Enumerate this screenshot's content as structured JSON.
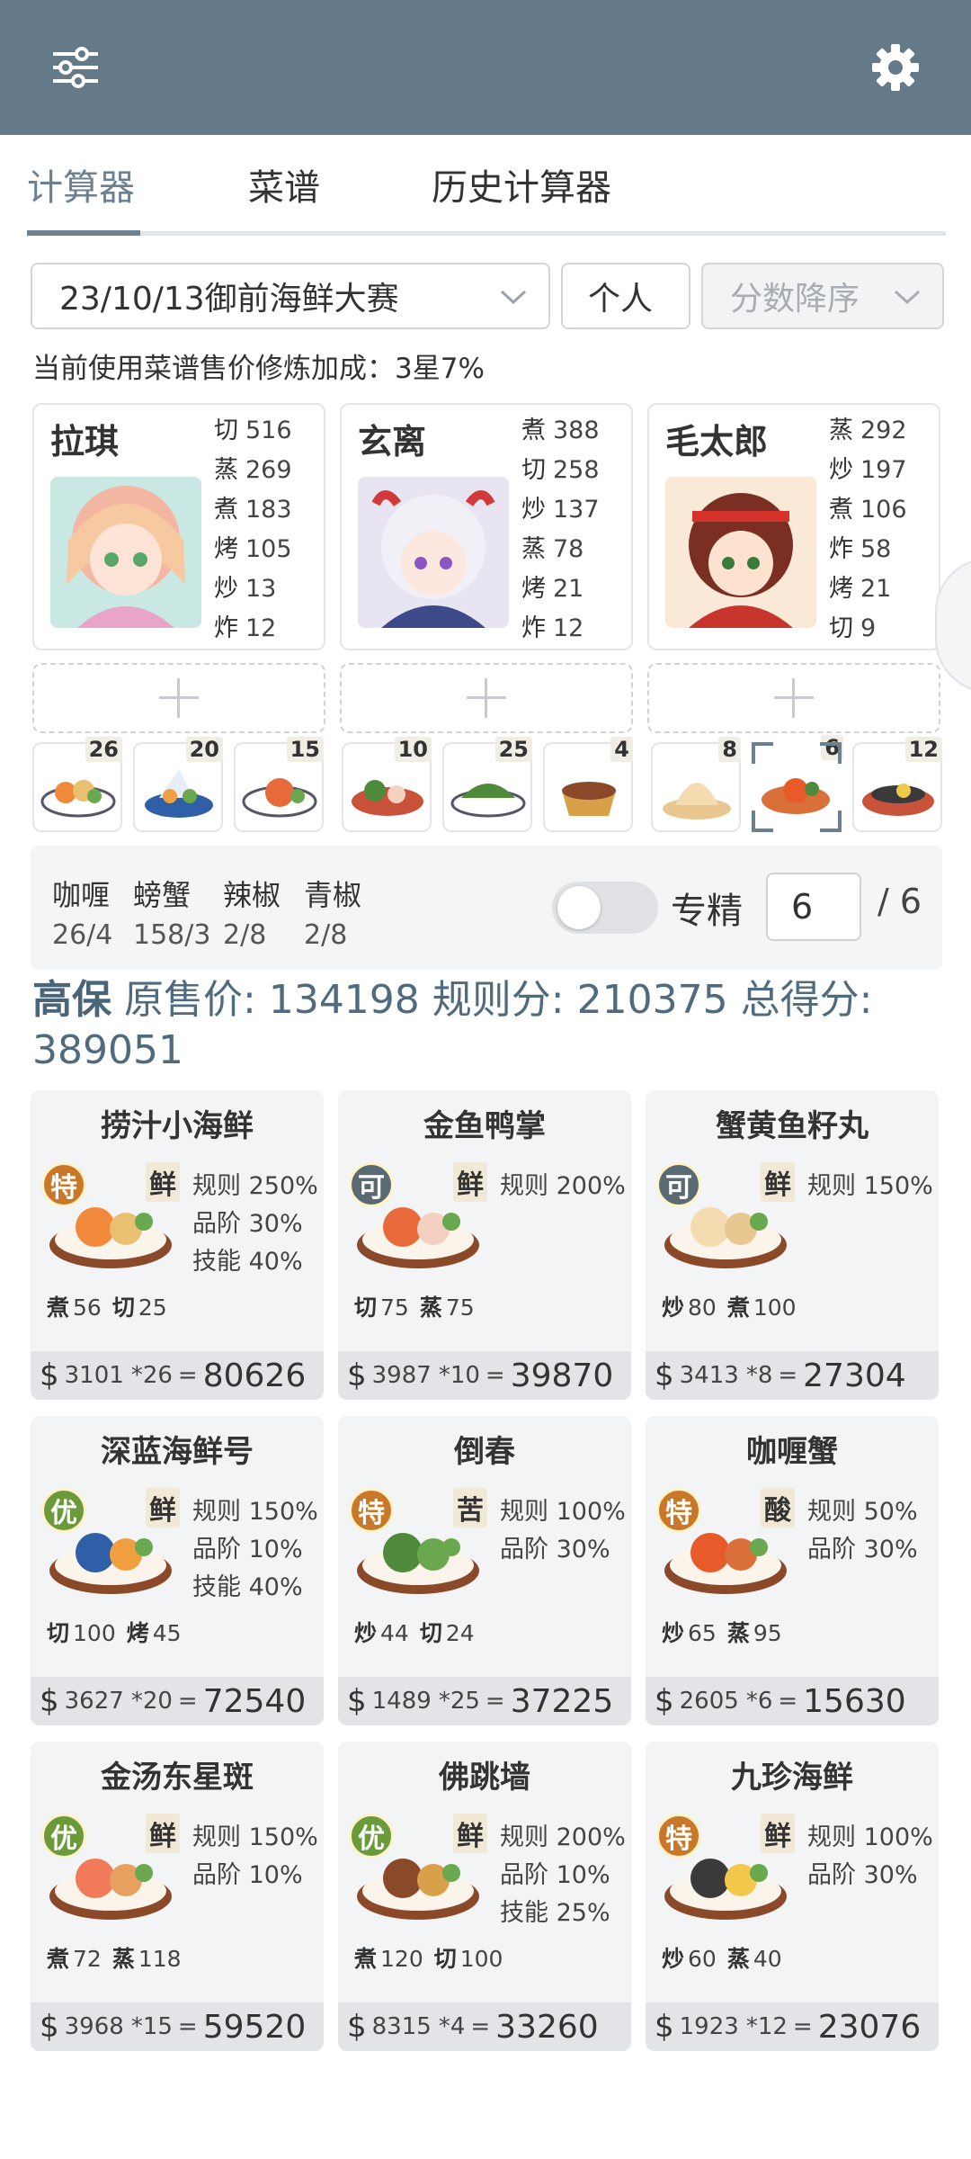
{
  "appbar": {
    "left_icon": "sliders-icon",
    "right_icon": "gear-icon"
  },
  "tabs": [
    {
      "label": "计算器",
      "active": true
    },
    {
      "label": "菜谱",
      "active": false
    },
    {
      "label": "历史计算器",
      "active": false
    }
  ],
  "filters": {
    "contest": "23/10/13御前海鲜大赛",
    "mode": "个人",
    "sort": "分数降序"
  },
  "bonus_text": "当前使用菜谱售价修炼加成：3星7%",
  "chefs": [
    {
      "name": "拉琪",
      "skills": [
        {
          "k": "切",
          "v": "516"
        },
        {
          "k": "蒸",
          "v": "269"
        },
        {
          "k": "煮",
          "v": "183"
        },
        {
          "k": "烤",
          "v": "105"
        },
        {
          "k": "炒",
          "v": "13"
        },
        {
          "k": "炸",
          "v": "12"
        }
      ]
    },
    {
      "name": "玄离",
      "skills": [
        {
          "k": "煮",
          "v": "388"
        },
        {
          "k": "切",
          "v": "258"
        },
        {
          "k": "炒",
          "v": "137"
        },
        {
          "k": "蒸",
          "v": "78"
        },
        {
          "k": "烤",
          "v": "21"
        },
        {
          "k": "炸",
          "v": "12"
        }
      ]
    },
    {
      "name": "毛太郎",
      "skills": [
        {
          "k": "蒸",
          "v": "292"
        },
        {
          "k": "炒",
          "v": "197"
        },
        {
          "k": "煮",
          "v": "106"
        },
        {
          "k": "炸",
          "v": "58"
        },
        {
          "k": "烤",
          "v": "21"
        },
        {
          "k": "切",
          "v": "9"
        }
      ]
    }
  ],
  "add_label": "+",
  "dish_counts": [
    "26",
    "20",
    "15",
    "10",
    "25",
    "4",
    "8",
    "6",
    "12"
  ],
  "ingredients": [
    {
      "name": "咖喱",
      "value": "26/4"
    },
    {
      "name": "螃蟹",
      "value": "158/3"
    },
    {
      "name": "辣椒",
      "value": "2/8"
    },
    {
      "name": "青椒",
      "value": "2/8"
    }
  ],
  "specialize": {
    "label": "专精",
    "value": "6",
    "total": "/ 6",
    "on": false
  },
  "summary": {
    "name": "高保",
    "orig_label": "原售价:",
    "orig": "134198",
    "rule_label": "规则分:",
    "rule": "210375",
    "total_label": "总得分:",
    "total": "389051"
  },
  "recipes": [
    {
      "name": "捞汁小海鲜",
      "badge": "特",
      "badge_color": "#c9782a",
      "tag": "鲜",
      "rules": [
        "规则 250%",
        "品阶 30%",
        "技能 40%"
      ],
      "skills": [
        {
          "k": "煮",
          "v": "56"
        },
        {
          "k": "切",
          "v": "25"
        }
      ],
      "price": "3101",
      "qty": "*26",
      "total": "80626"
    },
    {
      "name": "金鱼鸭掌",
      "badge": "可",
      "badge_color": "#5a6a72",
      "tag": "鲜",
      "rules": [
        "规则 200%"
      ],
      "skills": [
        {
          "k": "切",
          "v": "75"
        },
        {
          "k": "蒸",
          "v": "75"
        }
      ],
      "price": "3987",
      "qty": "*10",
      "total": "39870"
    },
    {
      "name": "蟹黄鱼籽丸",
      "badge": "可",
      "badge_color": "#5a6a72",
      "tag": "鲜",
      "rules": [
        "规则 150%"
      ],
      "skills": [
        {
          "k": "炒",
          "v": "80"
        },
        {
          "k": "煮",
          "v": "100"
        }
      ],
      "price": "3413",
      "qty": "*8",
      "total": "27304"
    },
    {
      "name": "深蓝海鲜号",
      "badge": "优",
      "badge_color": "#6a9a3a",
      "tag": "鲜",
      "rules": [
        "规则 150%",
        "品阶 10%",
        "技能 40%"
      ],
      "skills": [
        {
          "k": "切",
          "v": "100"
        },
        {
          "k": "烤",
          "v": "45"
        }
      ],
      "price": "3627",
      "qty": "*20",
      "total": "72540"
    },
    {
      "name": "倒春",
      "badge": "特",
      "badge_color": "#c9782a",
      "tag": "苦",
      "rules": [
        "规则 100%",
        "品阶 30%"
      ],
      "skills": [
        {
          "k": "炒",
          "v": "44"
        },
        {
          "k": "切",
          "v": "24"
        }
      ],
      "price": "1489",
      "qty": "*25",
      "total": "37225"
    },
    {
      "name": "咖喱蟹",
      "badge": "特",
      "badge_color": "#c9782a",
      "tag": "酸",
      "rules": [
        "规则 50%",
        "品阶 30%"
      ],
      "skills": [
        {
          "k": "炒",
          "v": "65"
        },
        {
          "k": "蒸",
          "v": "95"
        }
      ],
      "price": "2605",
      "qty": "*6",
      "total": "15630"
    },
    {
      "name": "金汤东星斑",
      "badge": "优",
      "badge_color": "#6a9a3a",
      "tag": "鲜",
      "rules": [
        "规则 150%",
        "品阶 10%"
      ],
      "skills": [
        {
          "k": "煮",
          "v": "72"
        },
        {
          "k": "蒸",
          "v": "118"
        }
      ],
      "price": "3968",
      "qty": "*15",
      "total": "59520"
    },
    {
      "name": "佛跳墙",
      "badge": "优",
      "badge_color": "#6a9a3a",
      "tag": "鲜",
      "rules": [
        "规则 200%",
        "品阶 10%",
        "技能 25%"
      ],
      "skills": [
        {
          "k": "煮",
          "v": "120"
        },
        {
          "k": "切",
          "v": "100"
        }
      ],
      "price": "8315",
      "qty": "*4",
      "total": "33260"
    },
    {
      "name": "九珍海鲜",
      "badge": "特",
      "badge_color": "#c9782a",
      "tag": "鲜",
      "rules": [
        "规则 100%",
        "品阶 30%"
      ],
      "skills": [
        {
          "k": "炒",
          "v": "60"
        },
        {
          "k": "蒸",
          "v": "40"
        }
      ],
      "price": "1923",
      "qty": "*12",
      "total": "23076"
    }
  ],
  "currency_symbol": "$",
  "equals": "="
}
